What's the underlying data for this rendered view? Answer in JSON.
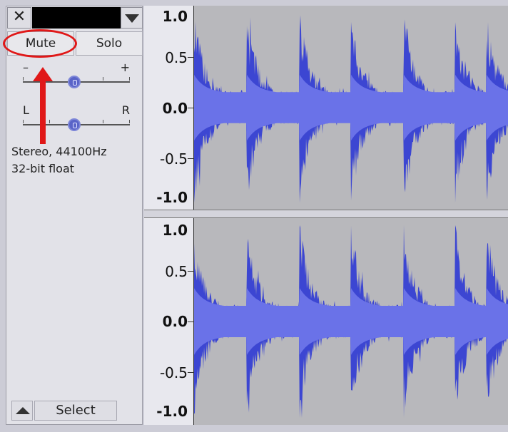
{
  "track_panel": {
    "close_glyph": "✕",
    "name": "",
    "mute_label": "Mute",
    "solo_label": "Solo",
    "gain_slider": {
      "min_label": "–",
      "max_label": "+",
      "value_fraction": 0.48
    },
    "pan_slider": {
      "left_label": "L",
      "right_label": "R",
      "value_fraction": 0.48
    },
    "info_line1": "Stereo, 44100Hz",
    "info_line2": "32-bit float",
    "select_label": "Select"
  },
  "ruler": {
    "labels": [
      "1.0",
      "0.5",
      "0.0",
      "-0.5",
      "-1.0"
    ]
  },
  "waveform": {
    "color": "#3c46d2",
    "rms_color": "#6a72e8",
    "background": "#b8b8bc"
  },
  "annotation": {
    "color": "#e01818",
    "target": "mute-button"
  },
  "icons": [
    "close-icon",
    "chevron-down-icon",
    "chevron-up-icon",
    "slider-thumb-icon",
    "arrow-annotation-icon"
  ]
}
